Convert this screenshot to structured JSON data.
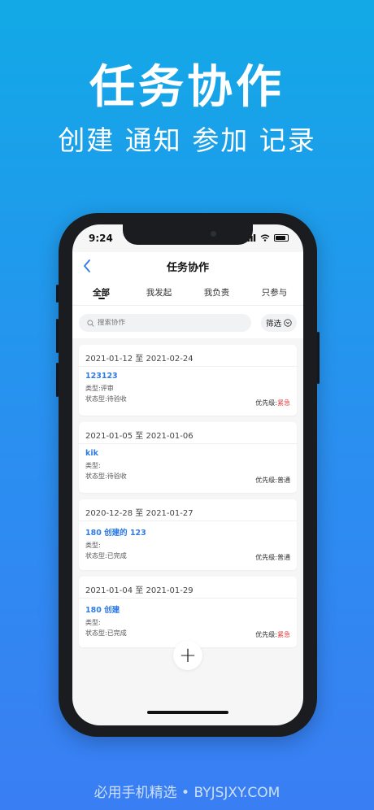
{
  "hero": {
    "title": "任务协作",
    "subtitle": "创建 通知 参加 记录"
  },
  "status_bar": {
    "time": "9:24"
  },
  "navbar": {
    "back_icon": "chevron-left-icon",
    "title": "任务协作"
  },
  "tabs": [
    {
      "label": "全部",
      "active": true
    },
    {
      "label": "我发起",
      "active": false
    },
    {
      "label": "我负责",
      "active": false
    },
    {
      "label": "只参与",
      "active": false
    }
  ],
  "search": {
    "placeholder": "搜索协作"
  },
  "filter": {
    "label": "筛选"
  },
  "cards": [
    {
      "date_range": "2021-01-12 至 2021-02-24",
      "name": "123123",
      "type": "类型:评审",
      "status": "状态型:待验收",
      "priority_label": "优先级:",
      "priority_value": "紧急",
      "priority_level": "urgent"
    },
    {
      "date_range": "2021-01-05 至 2021-01-06",
      "name": "kik",
      "type": "类型:",
      "status": "状态型:待验收",
      "priority_label": "优先级:",
      "priority_value": "普通",
      "priority_level": "normal"
    },
    {
      "date_range": "2020-12-28 至 2021-01-27",
      "name": "180 创建的 123",
      "type": "类型:",
      "status": "状态型:已完成",
      "priority_label": "优先级:",
      "priority_value": "普通",
      "priority_level": "normal"
    },
    {
      "date_range": "2021-01-04 至 2021-01-29",
      "name": "180 创建",
      "type": "类型:",
      "status": "状态型:已完成",
      "priority_label": "优先级:",
      "priority_value": "紧急",
      "priority_level": "urgent"
    }
  ],
  "add_button": {
    "label": "+"
  },
  "watermark": "必用手机精选 • BYJSJXY.COM",
  "colors": {
    "accent": "#2f7be5",
    "urgent": "#e03a3a",
    "background_top": "#12a9e6",
    "background_bottom": "#3a7ef4"
  }
}
